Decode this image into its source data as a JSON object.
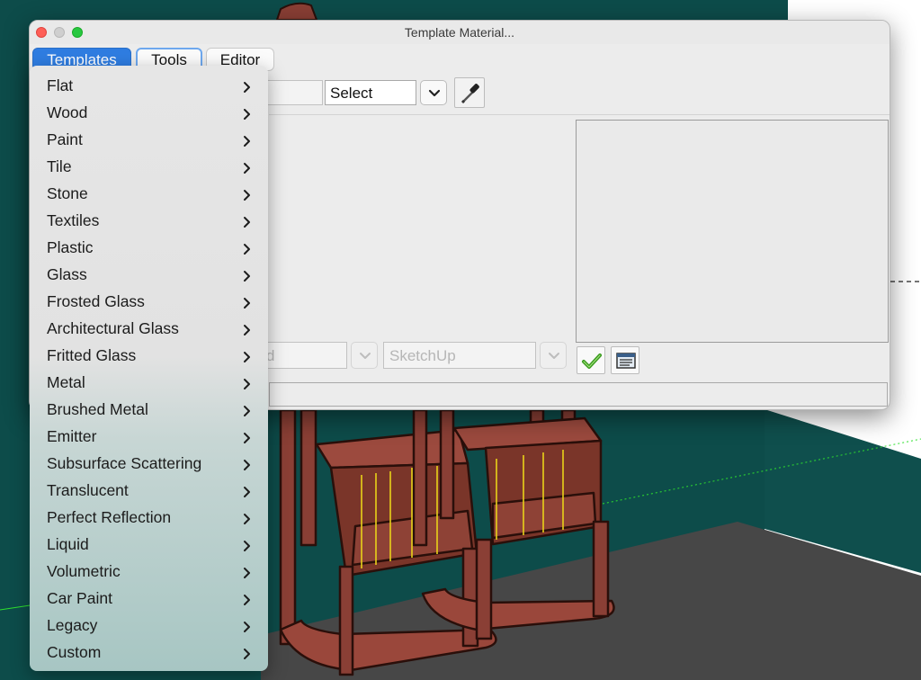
{
  "window": {
    "title": "Template Material..."
  },
  "tabs": [
    {
      "label": "Templates",
      "selected": true
    },
    {
      "label": "Tools",
      "selected": false
    },
    {
      "label": "Editor",
      "selected": false
    }
  ],
  "toolbar": {
    "select_value": "Select"
  },
  "library": {
    "source_value": "SketchUp",
    "partial_left_text": "d"
  },
  "icons": {
    "eyedropper": "eyedropper-icon",
    "apply": "checkmark-icon",
    "details": "list-panel-icon",
    "dropdown": "chevron-down-icon",
    "submenu": "chevron-right-icon"
  },
  "menu": {
    "items": [
      "Flat",
      "Wood",
      "Paint",
      "Tile",
      "Stone",
      "Textiles",
      "Plastic",
      "Glass",
      "Frosted Glass",
      "Architectural Glass",
      "Fritted Glass",
      "Metal",
      "Brushed Metal",
      "Emitter",
      "Subsurface Scattering",
      "Translucent",
      "Perfect Reflection",
      "Liquid",
      "Volumetric",
      "Car Paint",
      "Legacy",
      "Custom"
    ]
  },
  "colors": {
    "accent": "#2f7de1",
    "scene_wall": "#0d4c4a",
    "scene_floor": "#474747",
    "furniture": "#8a3f35",
    "apply_check": "#3a9a1f"
  }
}
